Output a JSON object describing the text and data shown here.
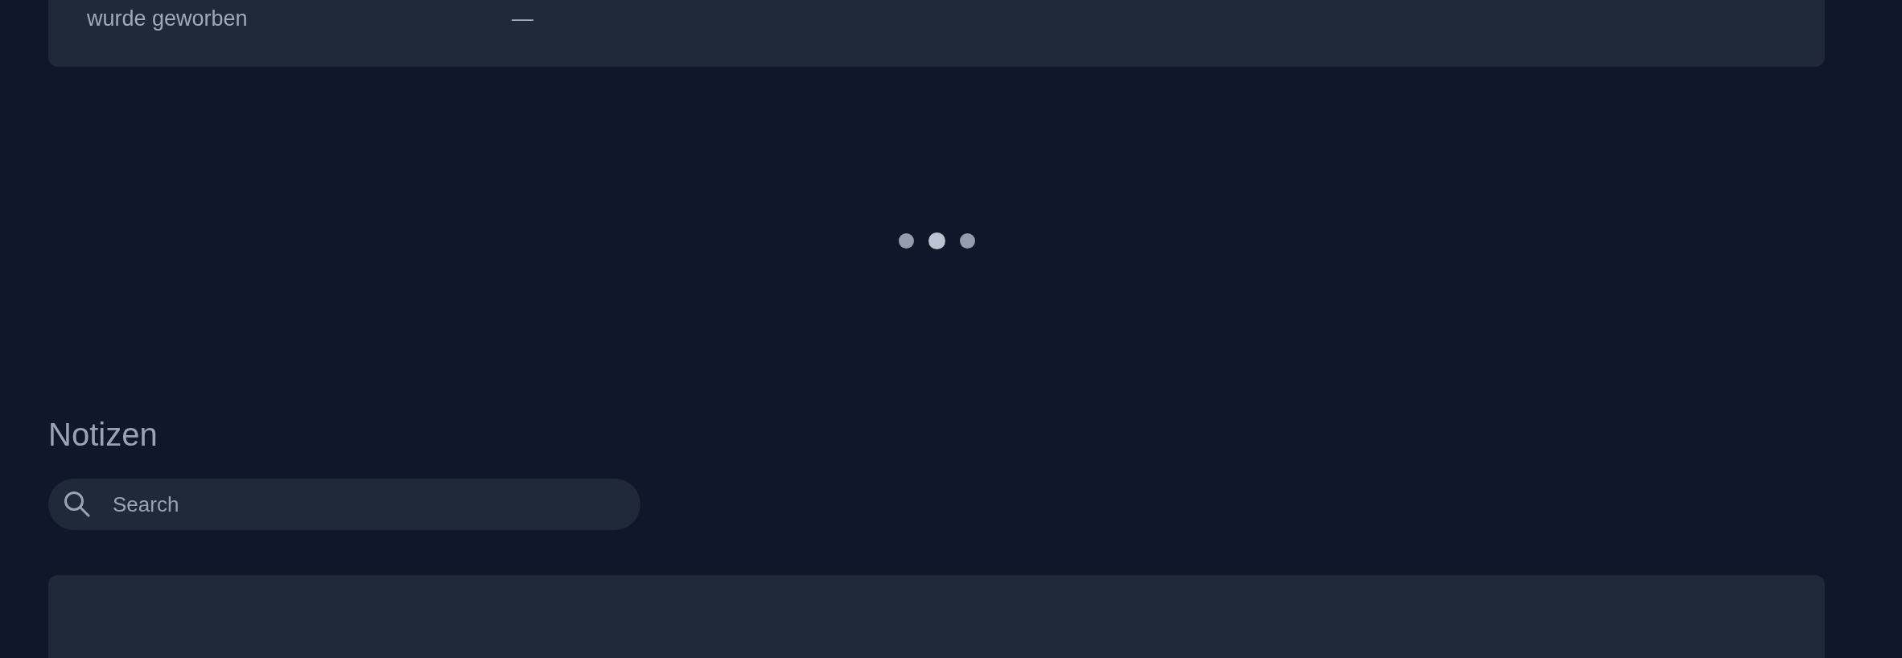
{
  "details_card": {
    "rows": [
      {
        "label": "wurde geworben",
        "value": "—"
      }
    ]
  },
  "loading": true,
  "notes": {
    "title": "Notizen",
    "search": {
      "placeholder": "Search"
    }
  }
}
